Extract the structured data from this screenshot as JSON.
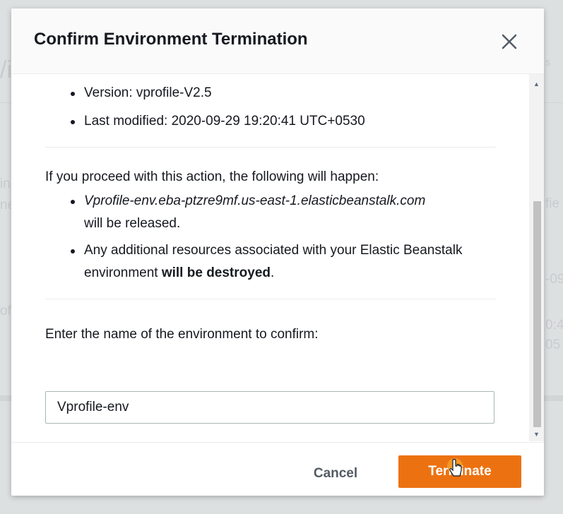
{
  "modal": {
    "title": "Confirm Environment Termination",
    "close_icon": "close-icon"
  },
  "details": [
    "Version: vprofile-V2.5",
    "Last modified: 2020-09-29 19:20:41 UTC+0530"
  ],
  "consequences": {
    "intro": "If you proceed with this action, the following will happen:",
    "items": [
      {
        "host": "Vprofile-env.eba-ptzre9mf.us-east-1.elasticbeanstalk.com",
        "suffix": "will be released."
      },
      {
        "text_start": "Any additional resources associated with your Elastic Beanstalk environment",
        "emphasis": "will be destroyed",
        "text_end": "."
      }
    ]
  },
  "confirm": {
    "label": "Enter the name of the environment to confirm:",
    "value": "Vprofile-env"
  },
  "footer": {
    "cancel_label": "Cancel",
    "terminate_label": "Terminate"
  },
  "colors": {
    "primary_button": "#ec7211",
    "cancel_text": "#545b64"
  }
}
